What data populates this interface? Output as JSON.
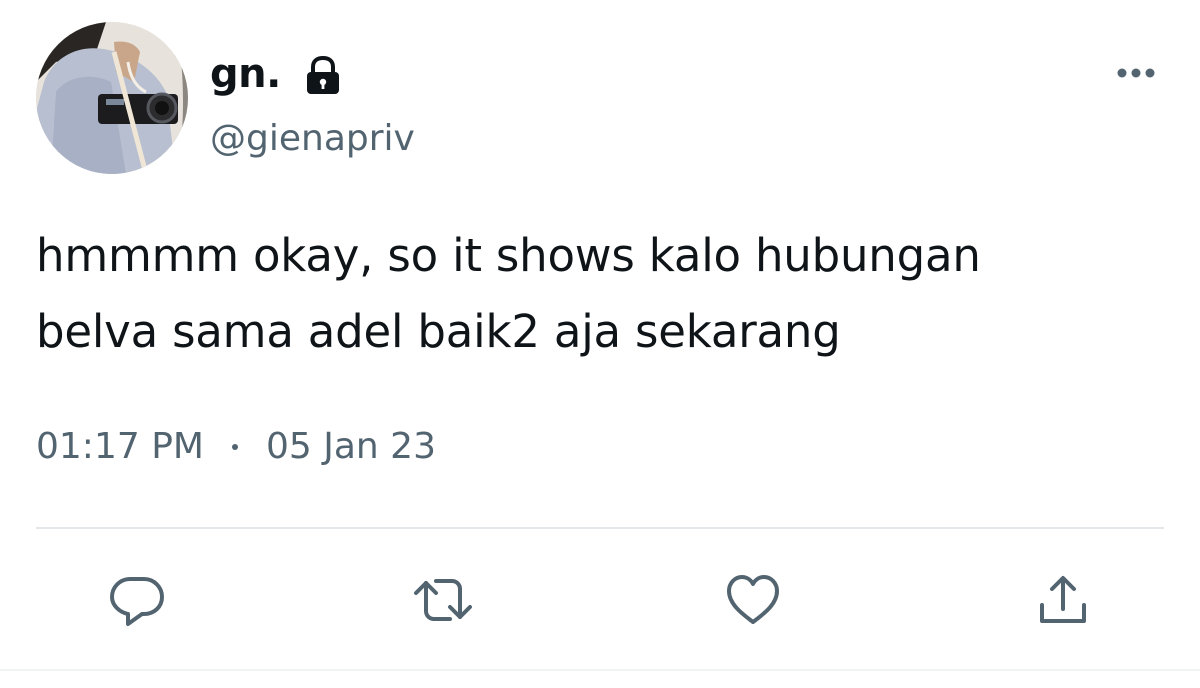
{
  "user": {
    "display_name": "gn.",
    "handle": "@gienapriv",
    "protected_icon": "lock-icon",
    "avatar_icon": "profile-photo"
  },
  "tweet": {
    "line1": "hmmmm okay, so it shows kalo hubungan",
    "line2": "belva sama adel baik2 aja sekarang",
    "time": "01:17 PM",
    "date": "05 Jan 23"
  },
  "actions": {
    "more_icon": "more-icon",
    "reply_icon": "reply-icon",
    "retweet_icon": "retweet-icon",
    "like_icon": "heart-icon",
    "share_icon": "share-icon"
  },
  "colors": {
    "text_primary": "#0f1419",
    "text_secondary": "#536471",
    "divider": "#e4e8eb"
  }
}
